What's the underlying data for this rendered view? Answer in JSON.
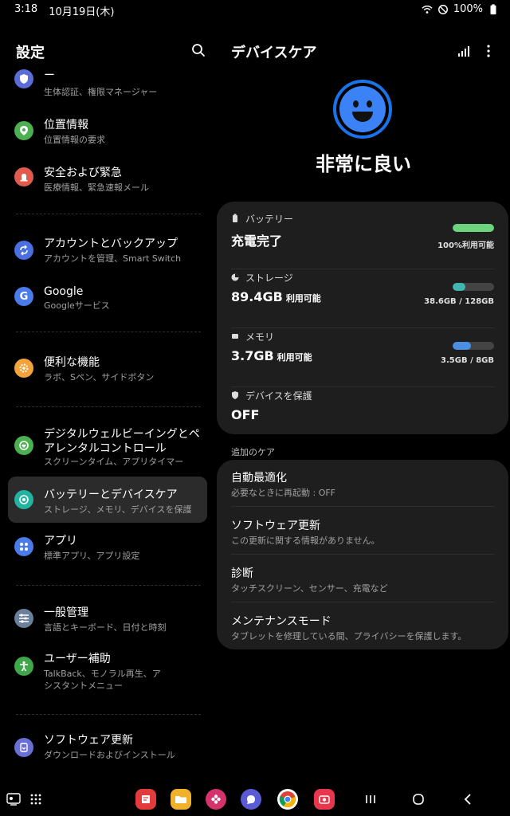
{
  "status_bar": {
    "time": "3:18",
    "date": "10月19日(木)",
    "battery": "100%"
  },
  "left": {
    "title": "設定",
    "items": [
      {
        "label": "ー",
        "sub": "生体認証、権限マネージャー",
        "icon": "shield-icon",
        "color": "#5b6cd8"
      },
      {
        "label": "位置情報",
        "sub": "位置情報の要求",
        "icon": "location-pin-icon",
        "color": "#4caf50"
      },
      {
        "label": "安全および緊急",
        "sub": "医療情報、緊急速報メール",
        "icon": "emergency-icon",
        "color": "#e05a4e"
      },
      {
        "label": "アカウントとバックアップ",
        "sub": "アカウントを管理、Smart Switch",
        "icon": "sync-icon",
        "color": "#4a6fe0"
      },
      {
        "label": "Google",
        "sub": "Googleサービス",
        "icon": "google-icon",
        "color": "#4a7be8"
      },
      {
        "label": "便利な機能",
        "sub": "ラボ、Sペン、サイドボタン",
        "icon": "gear-plus-icon",
        "color": "#f2a33a"
      },
      {
        "label": "デジタルウェルビーイングとペアレンタルコントロール",
        "sub": "スクリーンタイム、アプリタイマー",
        "icon": "wellbeing-icon",
        "color": "#4caf50"
      },
      {
        "label": "バッテリーとデバイスケア",
        "sub": "ストレージ、メモリ、デバイスを保護",
        "icon": "device-care-icon",
        "color": "#22b3a1"
      },
      {
        "label": "アプリ",
        "sub": "標準アプリ、アプリ設定",
        "icon": "apps-icon",
        "color": "#4a7be8"
      },
      {
        "label": "一般管理",
        "sub": "言語とキーボード、日付と時刻",
        "icon": "sliders-icon",
        "color": "#6a7f9a"
      },
      {
        "label": "ユーザー補助",
        "sub": "TalkBack、モノラル再生、アシスタントメニュー",
        "icon": "accessibility-icon",
        "color": "#3fa64a"
      },
      {
        "label": "ソフトウェア更新",
        "sub": "ダウンロードおよびインストール",
        "icon": "software-update-icon",
        "color": "#6a6fd8"
      }
    ]
  },
  "right": {
    "title": "デバイスケア",
    "status": "非常に良い",
    "battery": {
      "label": "バッテリー",
      "value": "充電完了",
      "bar_label": "100%利用可能",
      "level": 1.0,
      "color": "#6dd47e"
    },
    "storage": {
      "label": "ストレージ",
      "value": "89.4GB",
      "unit": "利用可能",
      "bar_label": "38.6GB / 128GB",
      "level": 0.3,
      "color": "#3fb6b0"
    },
    "memory": {
      "label": "メモリ",
      "value": "3.7GB",
      "unit": "利用可能",
      "bar_label": "3.5GB / 8GB",
      "level": 0.44,
      "color": "#4a8fe0"
    },
    "protect": {
      "label": "デバイスを保護",
      "value": "OFF"
    },
    "extra_label": "追加のケア",
    "extra": [
      {
        "title": "自動最適化",
        "sub": "必要なときに再起動 : OFF"
      },
      {
        "title": "ソフトウェア更新",
        "sub": "この更新に関する情報がありません。"
      },
      {
        "title": "診断",
        "sub": "タッチスクリーン、センサー、充電など"
      },
      {
        "title": "メンテナンスモード",
        "sub": "タブレットを修理している間、プライバシーを保護します。"
      }
    ]
  }
}
